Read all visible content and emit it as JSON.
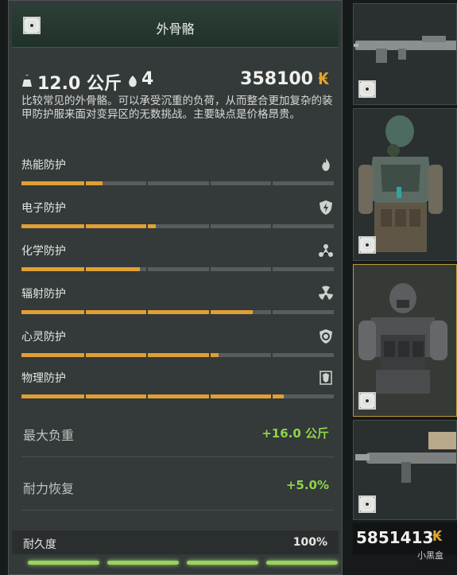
{
  "panel": {
    "title": "外骨骼",
    "weight": "12.0 公斤",
    "slots": "4",
    "price": "358100",
    "currency_symbol": "₭",
    "description": "比较常见的外骨骼。可以承受沉重的负荷，从而整合更加复杂的装甲防护服来面对变异区的无数挑战。主要缺点是价格昂贵。"
  },
  "protections": [
    {
      "label": "热能防护",
      "icon": "flame-icon",
      "fill": 0.26
    },
    {
      "label": "电子防护",
      "icon": "lightning-shield-icon",
      "fill": 0.43
    },
    {
      "label": "化学防护",
      "icon": "chemical-icon",
      "fill": 0.38
    },
    {
      "label": "辐射防护",
      "icon": "radiation-icon",
      "fill": 0.74
    },
    {
      "label": "心灵防护",
      "icon": "psy-shield-icon",
      "fill": 0.63
    },
    {
      "label": "物理防护",
      "icon": "armor-icon",
      "fill": 0.84
    }
  ],
  "attributes": [
    {
      "label": "最大负重",
      "value": "+16.0 公斤"
    },
    {
      "label": "耐力恢复",
      "value": "+5.0%"
    }
  ],
  "durability": {
    "label": "耐久度",
    "value": "100%",
    "segments": 4
  },
  "wallet": {
    "amount": "5851413",
    "currency_symbol": "₭"
  },
  "watermark": "小黑盒",
  "colors": {
    "accent": "#e0a033",
    "positive": "#8fd44a",
    "bar_bg": "#585c5d",
    "durability": "#9bd25e"
  }
}
